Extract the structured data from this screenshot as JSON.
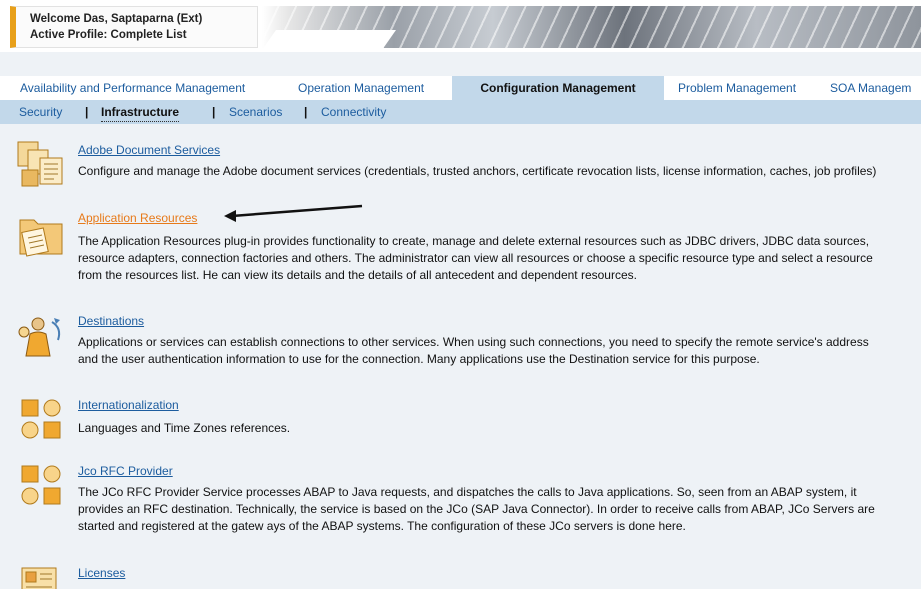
{
  "header": {
    "welcome": "Welcome Das, Saptaparna (Ext)",
    "profile": "Active Profile: Complete List"
  },
  "tabs": [
    {
      "label": "Availability and Performance Management",
      "active": false
    },
    {
      "label": "Operation Management",
      "active": false
    },
    {
      "label": "Configuration Management",
      "active": true
    },
    {
      "label": "Problem Management",
      "active": false
    },
    {
      "label": "SOA Managem",
      "active": false
    }
  ],
  "subnav": {
    "items": [
      "Security",
      "Infrastructure",
      "Scenarios",
      "Connectivity"
    ],
    "active": "Infrastructure",
    "separator": "|"
  },
  "services": [
    {
      "title": "Adobe Document Services",
      "icon": "document-services-icon",
      "desc": "Configure and manage the Adobe document services (credentials, trusted anchors, certificate revocation lists, license information, caches, job profiles)"
    },
    {
      "title": "Application Resources",
      "icon": "folder-document-icon",
      "highlighted": true,
      "desc": "The Application Resources plug-in provides functionality to create, manage and delete external resources such as JDBC drivers, JDBC data sources, resource adapters, connection factories and others. The administrator can view all resources or choose a specific resource type and select a resource from the resources list. He can view its details and the details of all antecedent and dependent resources."
    },
    {
      "title": "Destinations",
      "icon": "destinations-user-icon",
      "desc": "Applications or services can establish connections to other services. When using such connections, you need to specify the remote service's address and the user authentication information to use for the connection. Many applications use the Destination service for this purpose."
    },
    {
      "title": "Internationalization",
      "icon": "shapes-icon",
      "desc": "Languages and Time Zones references."
    },
    {
      "title": "Jco RFC Provider",
      "icon": "shapes-icon",
      "desc": "The JCo RFC Provider Service processes ABAP to Java requests, and dispatches the calls to Java applications. So, seen from an ABAP system, it provides an RFC destination. Technically, the service is based on the JCo (SAP Java Connector). In order to receive calls from ABAP, JCo Servers are started and registered at the gatew ays of the ABAP systems. The configuration of these JCo servers is done here."
    },
    {
      "title": "Licenses",
      "icon": "license-card-icon",
      "desc": ""
    }
  ],
  "colors": {
    "link": "#1c5c9e",
    "highlight_link": "#e77a1a",
    "tab_active_bg": "#c2d8ea",
    "accent": "#e8a01a"
  }
}
